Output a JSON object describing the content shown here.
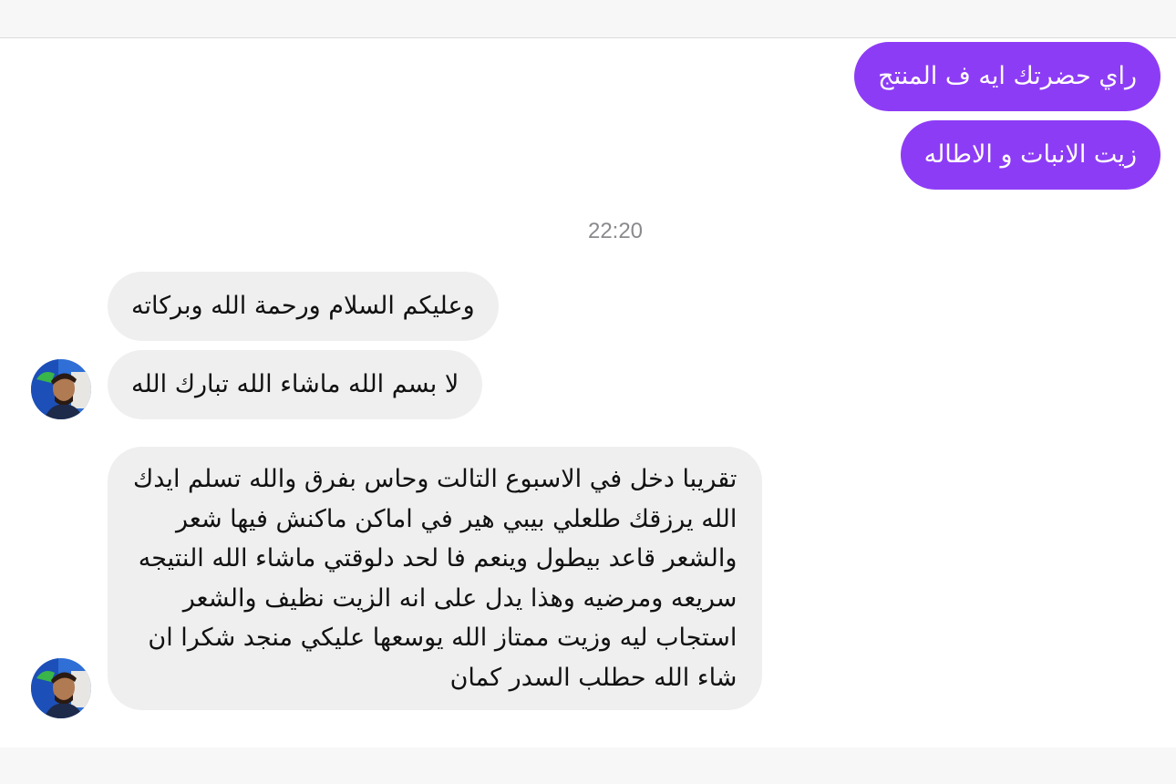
{
  "conversation": {
    "outgoing": [
      {
        "text": "راي حضرتك ايه ف المنتج"
      },
      {
        "text": "زيت الانبات و الاطاله"
      }
    ],
    "timestamp": "22:20",
    "incoming": [
      {
        "text": "وعليكم السلام ورحمة الله وبركاته"
      },
      {
        "text": "لا بسم الله ماشاء الله تبارك الله"
      },
      {
        "lines": [
          "تقريبا دخل في الاسبوع التالت وحاس بفرق والله تسلم ايدك",
          "الله يرزقك  طلعلي بيبي هير في اماكن ماكنش فيها شعر",
          "والشعر قاعد بيطول وينعم فا لحد دلوقتي ماشاء الله النتيجه",
          "سريعه ومرضيه وهذا يدل على انه الزيت نظيف والشعر",
          "استجاب ليه وزيت ممتاز الله يوسعها عليكي منجد شكرا ان",
          "شاء الله  حطلب السدر كمان"
        ]
      }
    ]
  },
  "colors": {
    "outgoing_bubble": "#8d3cf5",
    "incoming_bubble": "#efeff0",
    "timestamp": "#8a8a8e"
  }
}
